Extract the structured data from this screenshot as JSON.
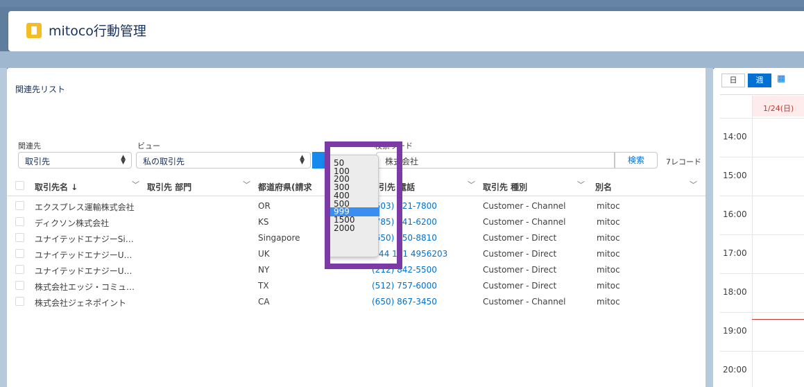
{
  "app": {
    "title": "mitoco行動管理",
    "icon": "document-icon"
  },
  "related_list": {
    "title": "関連先リスト",
    "filters": {
      "related_label": "関連先",
      "related_value": "取引先",
      "view_label": "ビュー",
      "view_value": "私の取引先",
      "search_label": "検索ワード",
      "search_value": "株式会社",
      "search_button": "検索",
      "record_count": "7レコード"
    },
    "columns": [
      "取引先名 ↓",
      "取引先 部門",
      "都道府県(請求",
      "取引先 電話",
      "取引先 種別",
      "別名"
    ],
    "rows": [
      {
        "name": "エクスプレス運輸株式会社",
        "dept": "",
        "state": "OR",
        "phone": "(503) 421-7800",
        "type": "Customer - Channel",
        "alias": "mitoc"
      },
      {
        "name": "ディクソン株式会社",
        "dept": "",
        "state": "KS",
        "phone": "(785) 241-6200",
        "type": "Customer - Channel",
        "alias": "mitoc"
      },
      {
        "name": "ユナイテッドエナジーSi…",
        "dept": "",
        "state": "Singapore",
        "phone": "(650) 450-8810",
        "type": "Customer - Direct",
        "alias": "mitoc"
      },
      {
        "name": "ユナイテッドエナジーU…",
        "dept": "",
        "state": "UK",
        "phone": "+44 191 4956203",
        "type": "Customer - Direct",
        "alias": "mitoc"
      },
      {
        "name": "ユナイテッドエナジーU…",
        "dept": "",
        "state": "NY",
        "phone": "(212) 842-5500",
        "type": "Customer - Direct",
        "alias": "mitoc"
      },
      {
        "name": "株式会社エッジ・コミュ…",
        "dept": "",
        "state": "TX",
        "phone": "(512) 757-6000",
        "type": "Customer - Direct",
        "alias": "mitoc"
      },
      {
        "name": "株式会社ジェネポイント",
        "dept": "",
        "state": "CA",
        "phone": "(650) 867-3450",
        "type": "Customer - Channel",
        "alias": "mitoc"
      }
    ]
  },
  "page_size_dropdown": {
    "options": [
      "50",
      "100",
      "200",
      "300",
      "400",
      "500",
      "999",
      "1500",
      "2000"
    ],
    "selected": "999"
  },
  "calendar": {
    "tabs": [
      "日",
      "週"
    ],
    "active_tab": "週",
    "date": "1/24(日)",
    "hours": [
      "14:00",
      "15:00",
      "16:00",
      "17:00",
      "18:00",
      "19:00",
      "20:00"
    ]
  },
  "colors": {
    "highlight": "#7b3aa6",
    "link": "#0070d2",
    "accent": "#1589ee"
  }
}
